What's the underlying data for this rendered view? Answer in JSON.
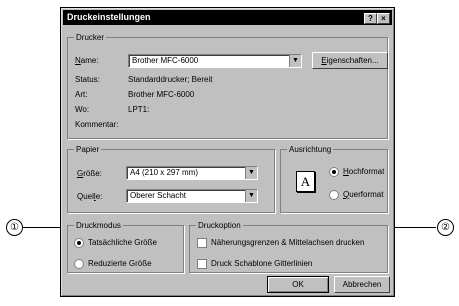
{
  "window": {
    "title": "Druckeinstellungen",
    "help_button": "?",
    "close_button": "×"
  },
  "printer": {
    "group_label": "Drucker",
    "name_label": "Name:",
    "name_value": "Brother MFC-6000",
    "properties_button": "Eigenschaften...",
    "status_label": "Status:",
    "status_value": "Standarddrucker; Bereit",
    "type_label": "Art:",
    "type_value": "Brother MFC-6000",
    "where_label": "Wo:",
    "where_value": "LPT1:",
    "comment_label": "Kommentar:"
  },
  "paper": {
    "group_label": "Papier",
    "size_label": "Größe:",
    "size_value": "A4 (210 x 297 mm)",
    "source_label": "Quelle:",
    "source_value": "Oberer Schacht"
  },
  "orientation": {
    "group_label": "Ausrichtung",
    "page_glyph": "A",
    "portrait": "Hochformat",
    "landscape": "Querformat",
    "selected": "portrait"
  },
  "print_mode": {
    "group_label": "Druckmodus",
    "actual": "Tatsächliche Größe",
    "reduced": "Reduzierte Größe",
    "selected": "actual"
  },
  "print_option": {
    "group_label": "Druckoption",
    "option1": "Näherungsgrenzen & Mittelachsen drucken",
    "option2": "Druck Schablone Gitterlinien"
  },
  "buttons": {
    "ok": "OK",
    "cancel": "Abbrechen"
  },
  "callouts": {
    "one": "①",
    "two": "②"
  }
}
